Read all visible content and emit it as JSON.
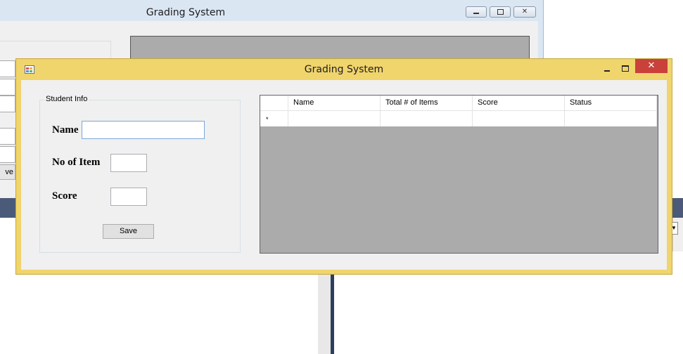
{
  "background_window": {
    "title": "Grading System",
    "save_button_fragment": "ve"
  },
  "window": {
    "title": "Grading System",
    "close_glyph": "✕"
  },
  "student_info": {
    "group_label": "Student Info",
    "name_label": "Name",
    "name_value": "",
    "items_label": "No of Item",
    "items_value": "",
    "score_label": "Score",
    "score_value": "",
    "save_label": "Save"
  },
  "grid": {
    "columns": [
      "Name",
      "Total # of Items",
      "Score",
      "Status"
    ],
    "new_row_marker": "*",
    "rows": []
  },
  "colors": {
    "window_frame": "#f0d46c",
    "close_button": "#c9413a",
    "grid_background": "#ababab"
  }
}
